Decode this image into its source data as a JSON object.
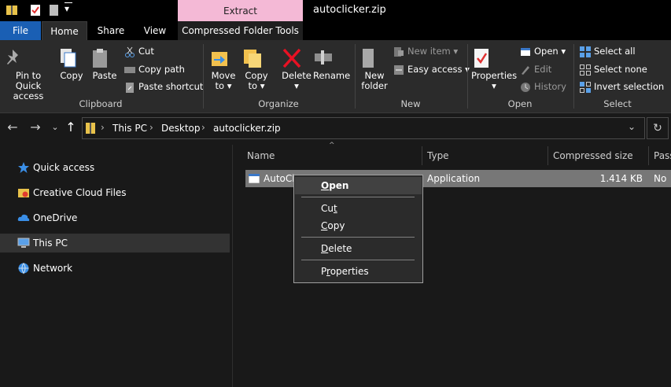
{
  "window": {
    "title": "autoclicker.zip",
    "context_tab_group": "Extract"
  },
  "tabs": {
    "file": "File",
    "home": "Home",
    "share": "Share",
    "view": "View",
    "compressed": "Compressed Folder Tools"
  },
  "ribbon": {
    "clipboard": {
      "pin_line1": "Pin to Quick",
      "pin_line2": "access",
      "copy": "Copy",
      "paste": "Paste",
      "cut": "Cut",
      "copy_path": "Copy path",
      "paste_shortcut": "Paste shortcut",
      "group": "Clipboard"
    },
    "organize": {
      "move_line1": "Move",
      "move_line2": "to ▾",
      "copyto_line1": "Copy",
      "copyto_line2": "to ▾",
      "delete_line1": "Delete",
      "delete_line2": "▾",
      "rename": "Rename",
      "group": "Organize"
    },
    "new": {
      "folder_line1": "New",
      "folder_line2": "folder",
      "new_item": "New item ▾",
      "easy_access": "Easy access ▾",
      "group": "New"
    },
    "open": {
      "properties_line1": "Properties",
      "properties_line2": "▾",
      "open": "Open ▾",
      "edit": "Edit",
      "history": "History",
      "group": "Open"
    },
    "select": {
      "select_all": "Select all",
      "select_none": "Select none",
      "invert": "Invert selection",
      "group": "Select"
    }
  },
  "address": {
    "crumbs": [
      "This PC",
      "Desktop",
      "autoclicker.zip"
    ]
  },
  "nav": {
    "quick_access": "Quick access",
    "creative_cloud": "Creative Cloud Files",
    "onedrive": "OneDrive",
    "this_pc": "This PC",
    "network": "Network"
  },
  "columns": {
    "name": "Name",
    "type": "Type",
    "compressed_size": "Compressed size",
    "password": "Pass"
  },
  "rows": [
    {
      "name": "AutoCl",
      "type": "Application",
      "compressed_size": "1.414 KB",
      "password": "No"
    }
  ],
  "context_menu": {
    "open_prefix": "",
    "open_ul": "O",
    "open_rest": "pen",
    "cut_prefix": "Cu",
    "cut_ul": "t",
    "cut_rest": "",
    "copy_prefix": "",
    "copy_ul": "C",
    "copy_rest": "opy",
    "delete_prefix": "",
    "delete_ul": "D",
    "delete_rest": "elete",
    "properties_prefix": "P",
    "properties_ul": "r",
    "properties_rest": "operties"
  },
  "colors": {
    "file_tab": "#1a5fb4",
    "extract_tab": "#f4b9d6",
    "selected_row": "#777777",
    "delete_red": "#e81123"
  }
}
